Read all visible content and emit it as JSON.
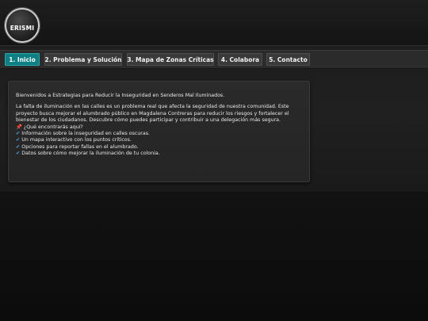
{
  "header": {
    "logo_text": "ERISMI"
  },
  "nav": {
    "tabs": [
      {
        "label": "1. Inicio",
        "active": true
      },
      {
        "label": "2. Problema y Solución",
        "active": false
      },
      {
        "label": "3. Mapa de Zonas Críticas",
        "active": false
      },
      {
        "label": "4. Colabora",
        "active": false
      },
      {
        "label": "5. Contacto",
        "active": false
      }
    ]
  },
  "content": {
    "welcome": "Bienvenidos a Estrategias para Reducir la Inseguridad en Senderos Mal Iluminados.",
    "body": "La falta de iluminación en las calles es un problema real que afecta la seguridad de nuestra comunidad. Este proyecto busca mejorar el alumbrado público en Magdalena Contreras para reducir los riesgos y fortalecer el bienestar de los ciudadanos. Descubre cómo puedes participar y contribuir a una delegación más segura.",
    "question": "¿Qué encontrarás aquí?",
    "items": [
      "Información sobre la inseguridad en calles oscuras.",
      "Un mapa interactivo con los puntos críticos.",
      "Opciones para reportar fallas en el alumbrado.",
      "Datos sobre cómo mejorar la iluminación de tu colonia."
    ],
    "pin_icon": "pin-icon",
    "check_icon": "check-icon"
  },
  "colors": {
    "accent": "#0e7f83",
    "background": "#1e1e1e"
  }
}
